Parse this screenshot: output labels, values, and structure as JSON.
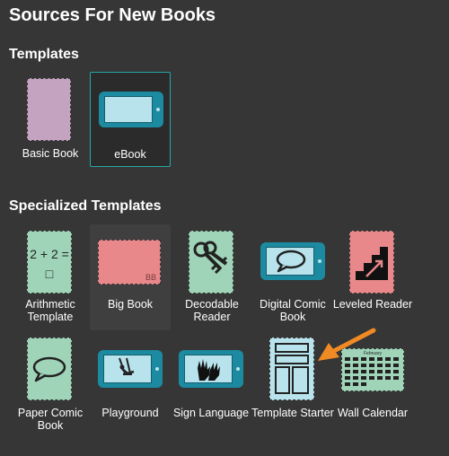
{
  "dialog": {
    "title": "Sources For New Books"
  },
  "sections": {
    "templates": "Templates",
    "specialized": "Specialized Templates"
  },
  "templates": [
    {
      "id": "basic-book",
      "label": "Basic Book"
    },
    {
      "id": "ebook",
      "label": "eBook"
    }
  ],
  "specialized": [
    {
      "id": "arithmetic",
      "label": "Arithmetic Template",
      "thumb_text": "2 + 2 = □"
    },
    {
      "id": "big-book",
      "label": "Big Book",
      "thumb_text": "BB"
    },
    {
      "id": "decodable",
      "label": "Decodable Reader"
    },
    {
      "id": "digital-comic",
      "label": "Digital Comic Book"
    },
    {
      "id": "leveled",
      "label": "Leveled Reader"
    },
    {
      "id": "paper-comic",
      "label": "Paper Comic Book"
    },
    {
      "id": "playground",
      "label": "Playground"
    },
    {
      "id": "sign-language",
      "label": "Sign Language"
    },
    {
      "id": "template-starter",
      "label": "Template Starter"
    },
    {
      "id": "wall-calendar",
      "label": "Wall Calendar",
      "thumb_text": "February"
    }
  ],
  "colors": {
    "background": "#363636",
    "lilac": "#c3a3c0",
    "mint": "#9fd4b8",
    "salmon": "#e8888a",
    "teal": "#1c8aa0",
    "light_blue": "#b8e3ec",
    "arrow_orange": "#f08a24",
    "selected_border": "#2aa6a6"
  }
}
